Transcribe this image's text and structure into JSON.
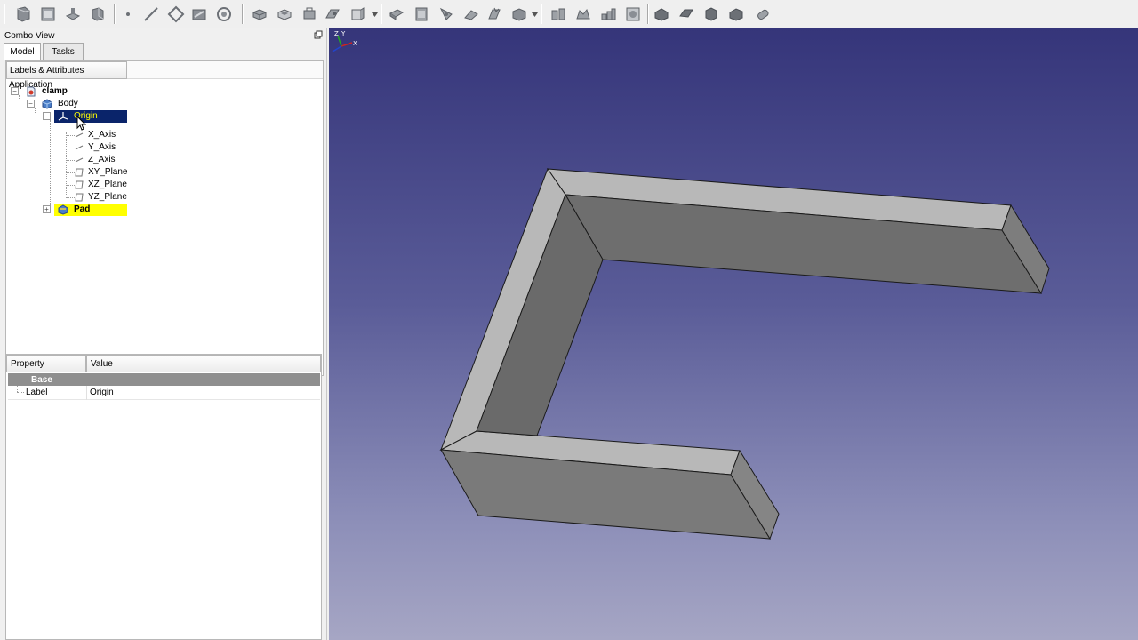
{
  "combo_view": {
    "title": "Combo View",
    "tabs": [
      {
        "label": "Model",
        "active": true
      },
      {
        "label": "Tasks",
        "active": false
      }
    ]
  },
  "tree": {
    "header": "Labels & Attributes",
    "root": "Application",
    "items": {
      "clamp": "clamp",
      "body": "Body",
      "origin": "Origin",
      "x_axis": "X_Axis",
      "y_axis": "Y_Axis",
      "z_axis": "Z_Axis",
      "xy_plane": "XY_Plane",
      "xz_plane": "XZ_Plane",
      "yz_plane": "YZ_Plane",
      "pad": "Pad"
    },
    "selected": "origin",
    "highlighted": "pad"
  },
  "properties": {
    "columns": [
      "Property",
      "Value"
    ],
    "group": "Base",
    "rows": [
      {
        "property": "Label",
        "value": "Origin"
      }
    ]
  },
  "toolbar": {
    "icons": [
      "new-icon",
      "open-icon",
      "save-icon",
      "part-icon",
      "point-icon",
      "line-icon",
      "plane-icon",
      "sketch-icon",
      "attach-icon",
      "pad-icon",
      "pocket-icon",
      "revolution-icon",
      "groove-icon",
      "loft-icon",
      "sweep-icon",
      "additive-primitive-icon",
      "subtractive-primitive-icon",
      "fillet-icon",
      "chamfer-icon",
      "draft-icon",
      "thickness-icon",
      "mirror-icon",
      "linear-pattern-icon",
      "polar-pattern-icon",
      "multitransform-icon",
      "boolean-icon",
      "view-front-icon",
      "view-top-icon",
      "view-right-icon",
      "view-iso-icon",
      "view-fit-icon"
    ]
  },
  "colors": {
    "selection_bg": "#0a246a",
    "selection_text": "#ffff00",
    "highlight_bg": "#ffff00",
    "viewport_top": "#35357a",
    "viewport_bottom": "#a6a6c4"
  },
  "axis_labels": {
    "x": "X",
    "y": "Y",
    "z": "Z"
  }
}
